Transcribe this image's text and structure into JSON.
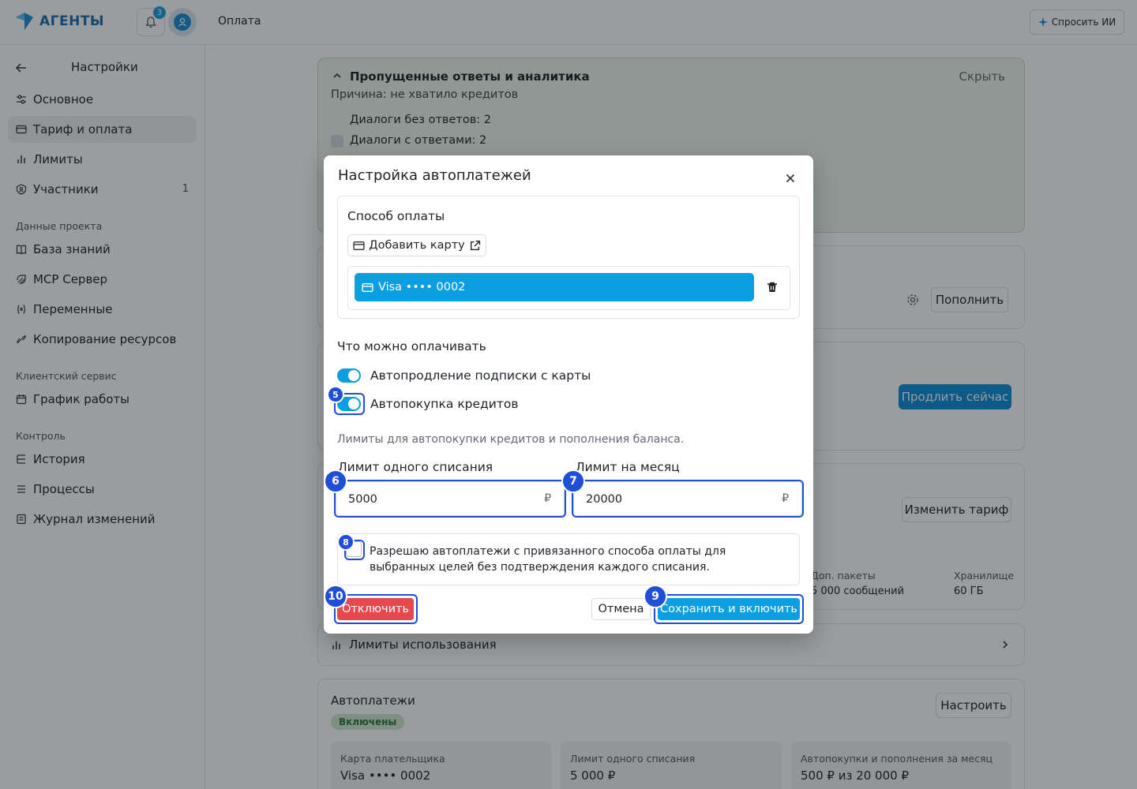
{
  "app": {
    "logo_text": "АГЕНТЫ",
    "notifications_count": "3",
    "breadcrumb": "Оплата",
    "ask_ai_label": "Спросить ИИ"
  },
  "sidebar": {
    "title": "Настройки",
    "items_main": [
      {
        "label": "Основное",
        "icon": "sliders-icon"
      },
      {
        "label": "Тариф и оплата",
        "icon": "credit-card-icon",
        "active": true
      },
      {
        "label": "Лимиты",
        "icon": "bar-chart-icon"
      },
      {
        "label": "Участники",
        "icon": "users-icon",
        "count": "1"
      }
    ],
    "group_project": "Данные проекта",
    "items_project": [
      {
        "label": "База знаний",
        "icon": "book-icon"
      },
      {
        "label": "MCP Сервер",
        "icon": "server-icon"
      },
      {
        "label": "Переменные",
        "icon": "variable-icon"
      },
      {
        "label": "Копирование ресурсов",
        "icon": "copy-icon"
      }
    ],
    "group_client": "Клиентский сервис",
    "items_client": [
      {
        "label": "График работы",
        "icon": "calendar-icon"
      }
    ],
    "group_control": "Контроль",
    "items_control": [
      {
        "label": "История",
        "icon": "history-icon"
      },
      {
        "label": "Процессы",
        "icon": "process-icon"
      },
      {
        "label": "Журнал изменений",
        "icon": "journal-icon"
      }
    ]
  },
  "background": {
    "missed": {
      "title": "Пропущенные ответы и аналитика",
      "hide": "Скрыть",
      "reason": "Причина: не хватило кредитов",
      "line1": "Диалоги без ответов: 2",
      "line2": "Диалоги с ответами: 2"
    },
    "topup_label": "Пополнить",
    "renew_now_label": "Продлить сейчас",
    "change_plan_label": "Изменить тариф",
    "extra_packs_label": "Доп. пакеты",
    "extra_packs_value": "5 000 сообщений",
    "storage_label": "Хранилище",
    "storage_value": "60 ГБ",
    "usage_limits_label": "Лимиты использования",
    "autopay": {
      "title": "Автоплатежи",
      "status": "Включены",
      "configure_label": "Настроить",
      "tiles": [
        {
          "label": "Карта плательщика",
          "value": "Visa •••• 0002"
        },
        {
          "label": "Лимит одного списания",
          "value": "5 000 ₽"
        },
        {
          "label": "Автопокупки и пополнения за месяц",
          "value": "500 ₽ из 20 000 ₽"
        }
      ]
    }
  },
  "modal": {
    "title": "Настройка автоплатежей",
    "payment_method_title": "Способ оплаты",
    "add_card_label": "Добавить карту",
    "card_label": "Visa •••• 0002",
    "what_to_pay_title": "Что можно оплачивать",
    "toggle_subscription_label": "Автопродление подписки с карты",
    "toggle_subscription_on": true,
    "toggle_credits_label": "Автопокупка кредитов",
    "toggle_credits_on": true,
    "limits_hint": "Лимиты для автопокупки кредитов и пополнения баланса.",
    "single_limit_label": "Лимит одного списания",
    "single_limit_value": "5000",
    "monthly_limit_label": "Лимит на месяц",
    "monthly_limit_value": "20000",
    "currency": "₽",
    "consent_text": "Разрешаю автоплатежи с привязанного способа оплаты для выбранных целей без подтверждения каждого списания.",
    "consent_checked": false,
    "disable_label": "Отключить",
    "cancel_label": "Отмена",
    "save_label": "Сохранить и включить"
  },
  "markers": [
    "5",
    "6",
    "7",
    "8",
    "9",
    "10"
  ],
  "colors": {
    "accent": "#0b9ee0",
    "danger": "#e5484d",
    "highlight": "#1f4fd9",
    "success_bg": "#eef8ef"
  }
}
